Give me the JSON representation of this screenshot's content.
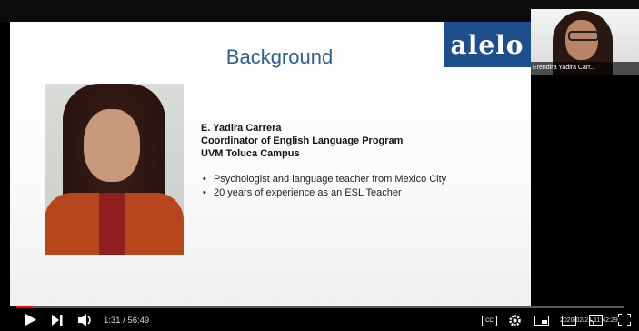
{
  "slide": {
    "title": "Background",
    "logo_text": "alelo",
    "name": "E. Yadira Carrera",
    "role": "Coordinator of English Language Program",
    "campus": "UVM Toluca Campus",
    "bullets": [
      "Psychologist and language teacher from Mexico City",
      "20 years of experience as an ESL Teacher"
    ]
  },
  "webcam": {
    "name_label": "Erendira Yadira Carr..."
  },
  "player": {
    "time_display": "1:31 / 56:49",
    "progress_fraction": 0.027,
    "date_overlay": "2020/02/21 11:42:29",
    "colors": {
      "progress": "#ff0000",
      "slide_title": "#2f5f95",
      "logo_bg": "#1f4e8c"
    },
    "icons": [
      "play-icon",
      "next-icon",
      "volume-icon",
      "cc-icon",
      "settings-icon",
      "miniplayer-icon",
      "theater-icon",
      "cast-icon",
      "fullscreen-icon"
    ]
  }
}
